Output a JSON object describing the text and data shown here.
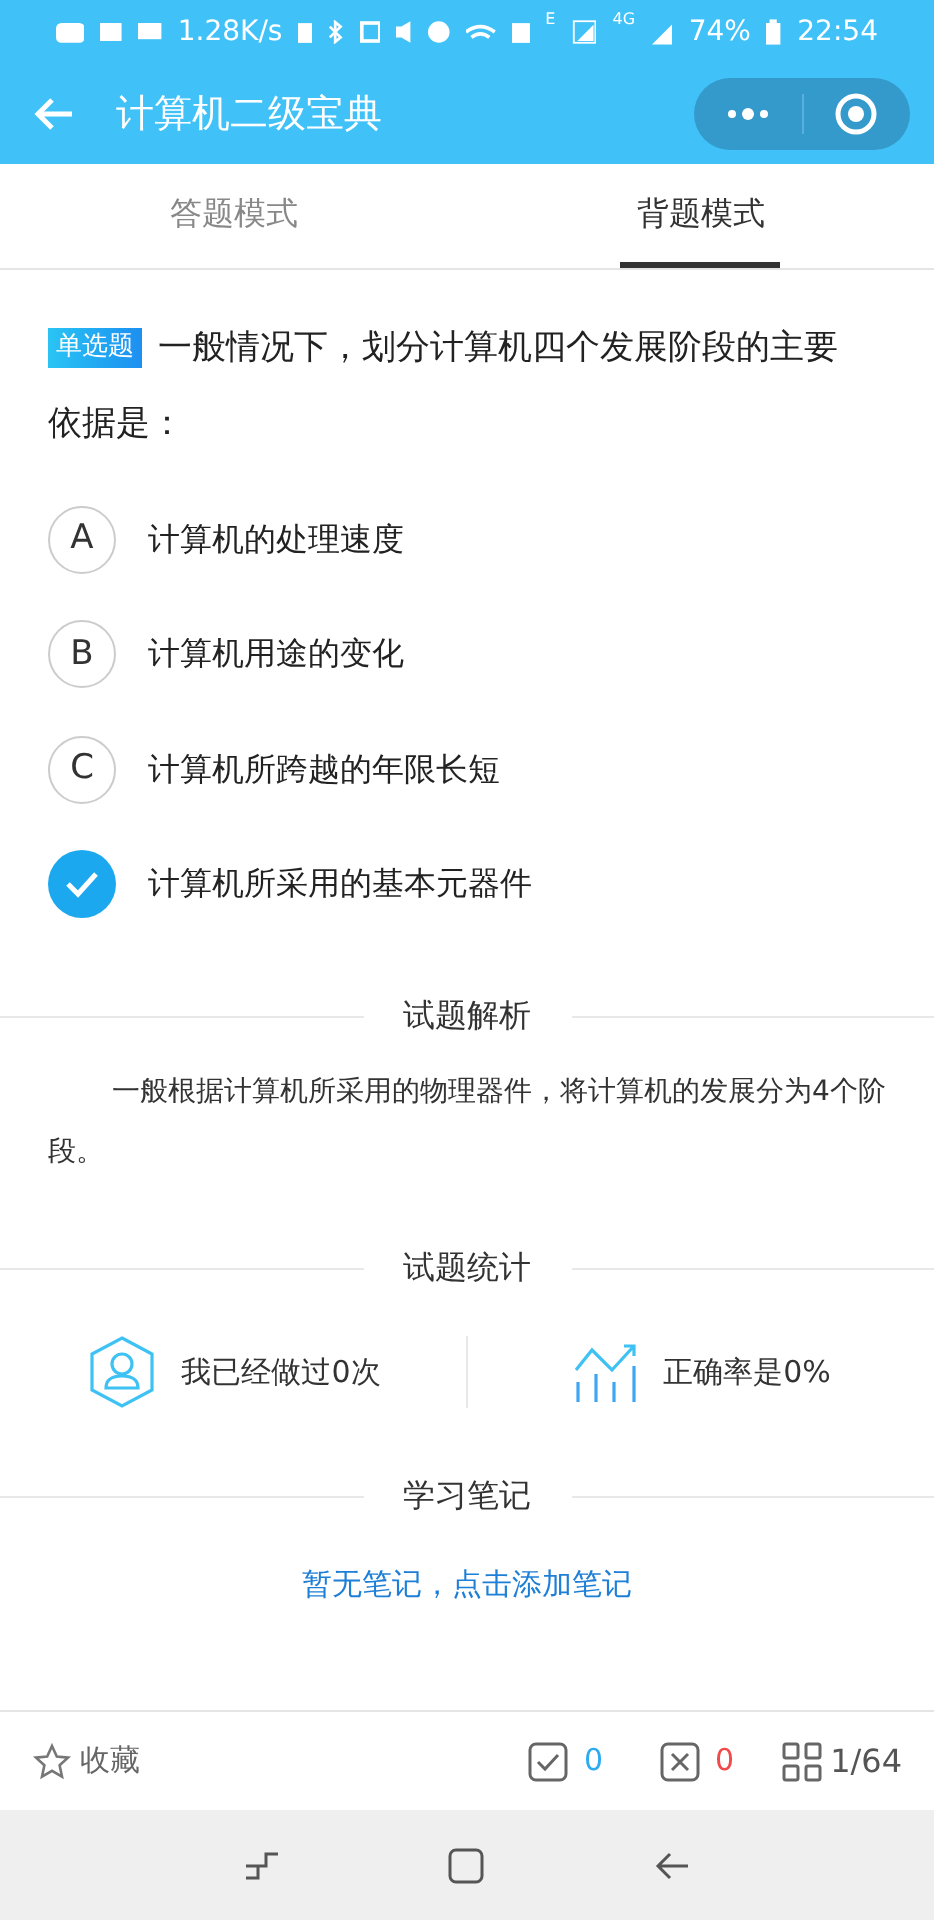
{
  "status_bar": {
    "speed": "1.28K/s",
    "network_e": "E",
    "network_4g": "4G",
    "battery": "74%",
    "time": "22:54"
  },
  "header": {
    "title": "计算机二级宝典"
  },
  "tabs": [
    {
      "label": "答题模式",
      "selected": false
    },
    {
      "label": "背题模式",
      "selected": true
    }
  ],
  "question": {
    "type_badge": "单选题",
    "text": "一般情况下，划分计算机四个发展阶段的主要依据是：",
    "options": [
      {
        "letter": "A",
        "text": "计算机的处理速度",
        "selected": false
      },
      {
        "letter": "B",
        "text": "计算机用途的变化",
        "selected": false
      },
      {
        "letter": "C",
        "text": "计算机所跨越的年限长短",
        "selected": false
      },
      {
        "text": "计算机所采用的基本元器件",
        "selected": true
      }
    ]
  },
  "analysis": {
    "heading": "试题解析",
    "text": "一般根据计算机所采用的物理器件，将计算机的发展分为4个阶段。"
  },
  "stats": {
    "heading": "试题统计",
    "done": "我已经做过0次",
    "accuracy": "正确率是0%"
  },
  "notes": {
    "heading": "学习笔记",
    "link": "暂无笔记，点击添加笔记"
  },
  "bottom_bar": {
    "favorite": "收藏",
    "correct": "0",
    "wrong": "0",
    "progress": "1/64"
  }
}
